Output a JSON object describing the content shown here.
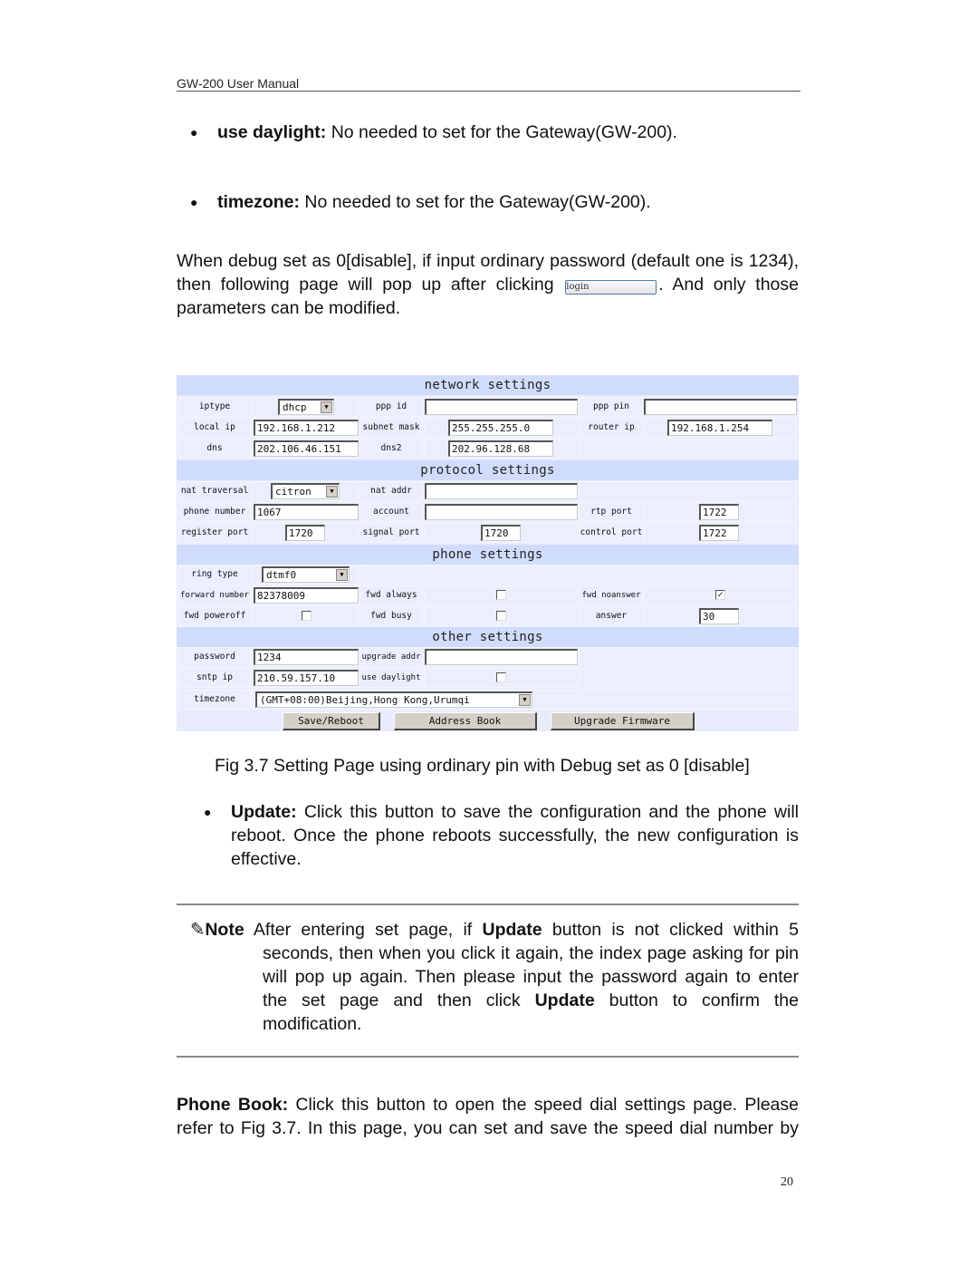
{
  "header": {
    "title": "GW-200 User Manual"
  },
  "bullets_top": [
    {
      "term": "use daylight:",
      "text": " No needed to set for the Gateway(GW-200)."
    },
    {
      "term": "timezone:",
      "text": " No needed to set for the Gateway(GW-200)."
    }
  ],
  "intro": {
    "line1": "When debug set as 0[disable], if input ordinary password (default one is 1234),",
    "line2_before": "then following page will pop up after clicking",
    "login_button": "login",
    "line2_after": ". And only those",
    "line3": "parameters can be modified."
  },
  "settings_page": {
    "sections": {
      "network": "network settings",
      "protocol": "protocol settings",
      "phone": "phone settings",
      "other": "other settings"
    },
    "network": {
      "iptype_label": "iptype",
      "iptype_value": "dhcp",
      "ppp_id_label": "ppp id",
      "ppp_id_value": "",
      "ppp_pin_label": "ppp pin",
      "ppp_pin_value": "",
      "local_ip_label": "local ip",
      "local_ip_value": "192.168.1.212",
      "subnet_mask_label": "subnet mask",
      "subnet_mask_value": "255.255.255.0",
      "router_ip_label": "router ip",
      "router_ip_value": "192.168.1.254",
      "dns_label": "dns",
      "dns_value": "202.106.46.151",
      "dns2_label": "dns2",
      "dns2_value": "202.96.128.68"
    },
    "protocol": {
      "nat_traversal_label": "nat traversal",
      "nat_traversal_value": "citron",
      "nat_addr_label": "nat addr",
      "nat_addr_value": "",
      "phone_number_label": "phone number",
      "phone_number_value": "1067",
      "account_label": "account",
      "account_value": "",
      "rtp_port_label": "rtp port",
      "rtp_port_value": "1722",
      "register_port_label": "register port",
      "register_port_value": "1720",
      "signal_port_label": "signal port",
      "signal_port_value": "1720",
      "control_port_label": "control port",
      "control_port_value": "1722"
    },
    "phone": {
      "ring_type_label": "ring type",
      "ring_type_value": "dtmf0",
      "forward_number_label": "forward number",
      "forward_number_value": "82378009",
      "fwd_always_label": "fwd always",
      "fwd_always_checked": false,
      "fwd_noanswer_label": "fwd noanswer",
      "fwd_noanswer_checked": true,
      "fwd_poweroff_label": "fwd poweroff",
      "fwd_poweroff_checked": false,
      "fwd_busy_label": "fwd busy",
      "fwd_busy_checked": false,
      "answer_label": "answer",
      "answer_value": "30"
    },
    "other": {
      "password_label": "password",
      "password_value": "1234",
      "upgrade_addr_label": "upgrade addr",
      "upgrade_addr_value": "",
      "sntp_ip_label": "sntp ip",
      "sntp_ip_value": "210.59.157.10",
      "use_daylight_label": "use daylight",
      "use_daylight_checked": false,
      "timezone_label": "timezone",
      "timezone_value": "(GMT+08:00)Beijing,Hong Kong,Urumqi"
    },
    "buttons": {
      "save_reboot": "Save/Reboot",
      "address_book": "Address Book",
      "upgrade_firmware": "Upgrade Firmware"
    }
  },
  "caption": "Fig 3.7 Setting Page using ordinary pin with Debug set as 0 [disable]",
  "update_bullet": {
    "term": "Update:",
    "line1": " Click this button to save the configuration and the phone will",
    "line2": "reboot. Once the phone reboots successfully, the new configuration is",
    "line3": "effective."
  },
  "note": {
    "icon": "✎",
    "label": "Note",
    "line1_a": " After entering set page, if ",
    "line1_b": "Update",
    "line1_c": " button is not clicked within 5",
    "line2": "seconds, then when you click it again, the index page asking for pin",
    "line3": "will pop up again. Then please input the password again to enter",
    "line4_a": "the set page and then click ",
    "line4_b": "Update",
    "line4_c": " button to confirm the",
    "line5": "modification."
  },
  "phone_book": {
    "term": "Phone Book:",
    "line1": " Click this button to open the speed dial settings page. Please",
    "line2": "refer to Fig 3.7. In this page, you can set and save the speed dial number by"
  },
  "page_number": "20"
}
